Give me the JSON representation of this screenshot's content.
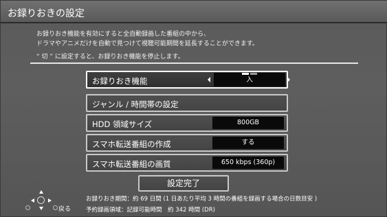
{
  "header": {
    "title": "お録りおきの設定"
  },
  "description": {
    "line1": "お録りおき機能を有効にすると全自動録画した番組の中から、",
    "line2": "ドラマやアニメだけを自動で見つけて視聴可能期間を延長することができます。",
    "line3": "“ 切 ” に設定すると、お録りおき機能を停止します。"
  },
  "settings": [
    {
      "label": "お録りおき機能",
      "value": "入"
    },
    {
      "label": "ジャンル / 時間帯の設定",
      "value": ""
    },
    {
      "label": "HDD 領域サイズ",
      "value": "800GB"
    },
    {
      "label": "スマホ転送番組の作成",
      "value": "する"
    },
    {
      "label": "スマホ転送番組の画質",
      "value": "650 kbps (360p)"
    }
  ],
  "done_label": "設定完了",
  "nav": {
    "back_label": "戻る"
  },
  "footer": {
    "line1": "お録りおき期間：約 69 日間 (1 日あたり平均 3 時間の番組を録画する場合の日数目安 )",
    "line2": "予約録画領域：記録可能時間　約 342 時間 (DR)"
  },
  "icons": [
    "left-arrow-icon",
    "right-arrow-icon",
    "dpad-icon",
    "back-button-icon"
  ],
  "colors": {
    "background": "#5a5a5a",
    "value_box": "#0a0a0a",
    "border": "#c9c9c9"
  }
}
